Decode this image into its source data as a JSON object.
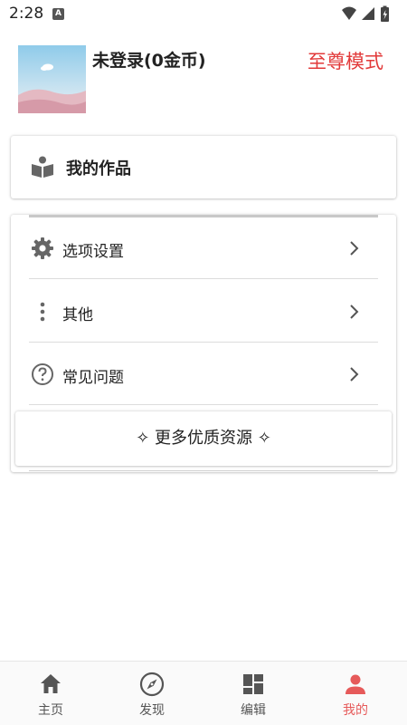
{
  "status_bar": {
    "time": "2:28",
    "notification_badge": "A",
    "icons": [
      "wifi-icon",
      "signal-icon",
      "battery-charging-icon"
    ]
  },
  "header": {
    "user_name": "未登录(0金币)",
    "premium_link": "至尊模式"
  },
  "works": {
    "label": "我的作品",
    "icon": "book-reader-icon"
  },
  "menu": {
    "items": [
      {
        "label": "选项设置",
        "icon": "gear-icon"
      },
      {
        "label": "其他",
        "icon": "more-vertical-icon"
      },
      {
        "label": "常见问题",
        "icon": "help-circle-icon"
      }
    ],
    "more_button": "✧ 更多优质资源 ✧"
  },
  "bottom_nav": {
    "tabs": [
      {
        "label": "主页",
        "icon": "home-icon",
        "active": false
      },
      {
        "label": "发现",
        "icon": "compass-icon",
        "active": false
      },
      {
        "label": "编辑",
        "icon": "dashboard-icon",
        "active": false
      },
      {
        "label": "我的",
        "icon": "person-icon",
        "active": true
      }
    ]
  },
  "colors": {
    "accent": "#e65a5a",
    "premium": "#e23a3a",
    "icon_gray": "#666666"
  }
}
